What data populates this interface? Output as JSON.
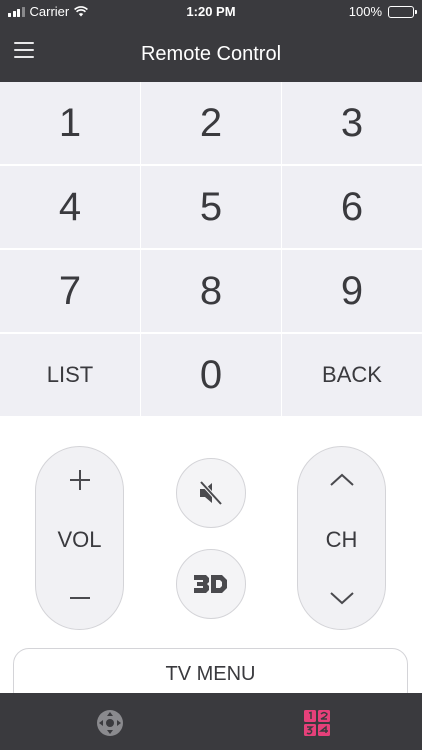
{
  "status_bar": {
    "carrier": "Carrier",
    "time": "1:20 PM",
    "battery": "100%"
  },
  "header": {
    "title": "Remote Control",
    "menu_icon": "hamburger-menu-icon"
  },
  "keypad": {
    "keys": [
      "1",
      "2",
      "3",
      "4",
      "5",
      "6",
      "7",
      "8",
      "9",
      "LIST",
      "0",
      "BACK"
    ]
  },
  "volume": {
    "label": "VOL",
    "up_icon": "plus-icon",
    "down_icon": "minus-icon"
  },
  "channel": {
    "label": "CH",
    "up_icon": "chevron-up-icon",
    "down_icon": "chevron-down-icon"
  },
  "mute": {
    "icon": "mute-speaker-icon"
  },
  "three_d": {
    "icon": "3d-icon"
  },
  "tv_menu": {
    "label": "TV MENU"
  },
  "tab_bar": {
    "tabs": [
      {
        "icon": "dpad-icon",
        "active": false
      },
      {
        "icon": "numpad-icon",
        "active": true
      }
    ]
  },
  "colors": {
    "bar_background": "#3a3a3e",
    "key_background": "#efeff4",
    "text": "#3a3a3e",
    "active_tab": "#e6407a",
    "inactive_tab": "#8a8a8e"
  }
}
